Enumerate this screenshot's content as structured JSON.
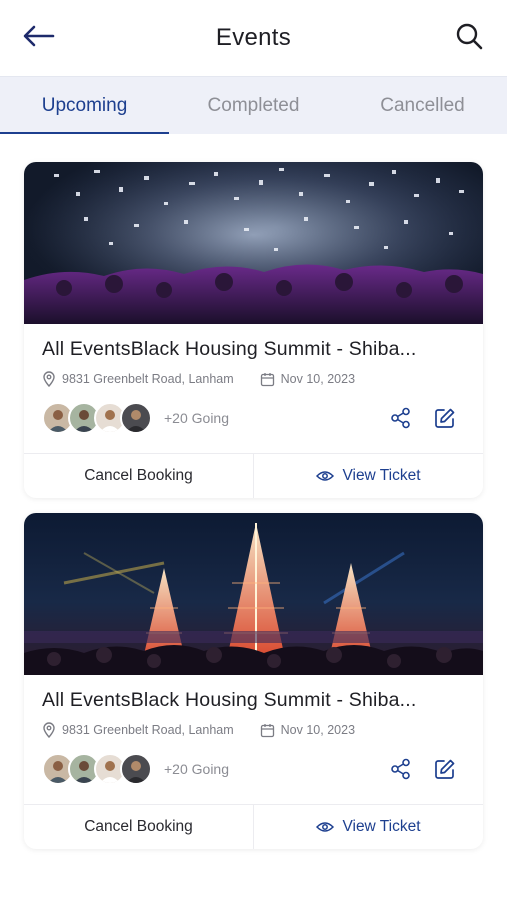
{
  "header": {
    "title": "Events"
  },
  "tabs": [
    {
      "label": "Upcoming"
    },
    {
      "label": "Completed"
    },
    {
      "label": "Cancelled"
    }
  ],
  "events": [
    {
      "title": "All EventsBlack Housing Summit - Shiba...",
      "location": "9831 Greenbelt Road, Lanham",
      "date": "Nov 10, 2023",
      "going": "+20 Going",
      "cancel_label": "Cancel Booking",
      "view_label": "View Ticket"
    },
    {
      "title": "All EventsBlack Housing Summit - Shiba...",
      "location": "9831 Greenbelt Road, Lanham",
      "date": "Nov 10, 2023",
      "going": "+20 Going",
      "cancel_label": "Cancel Booking",
      "view_label": "View Ticket"
    }
  ],
  "colors": {
    "accent": "#1d3f8f",
    "tab_bg": "#eef0f8"
  },
  "icons": [
    "arrow-left-icon",
    "search-icon",
    "location-pin-icon",
    "calendar-icon",
    "share-icon",
    "edit-icon",
    "eye-icon"
  ]
}
